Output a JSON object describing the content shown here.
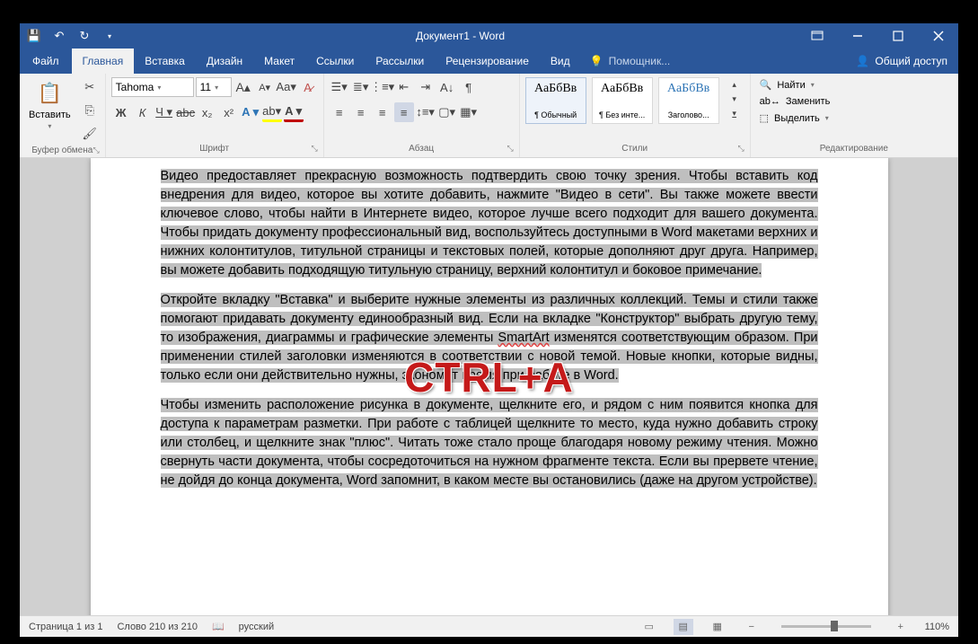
{
  "title": "Документ1 - Word",
  "tabs": {
    "file": "Файл",
    "home": "Главная",
    "insert": "Вставка",
    "design": "Дизайн",
    "layout": "Макет",
    "references": "Ссылки",
    "mailings": "Рассылки",
    "review": "Рецензирование",
    "view": "Вид"
  },
  "tell_me": "Помощник...",
  "share": "Общий доступ",
  "ribbon": {
    "clipboard": {
      "label": "Буфер обмена",
      "paste": "Вставить"
    },
    "font": {
      "label": "Шрифт",
      "name": "Tahoma",
      "size": "11"
    },
    "paragraph": {
      "label": "Абзац"
    },
    "styles": {
      "label": "Стили",
      "items": [
        {
          "preview": "АаБбВв",
          "name": "¶ Обычный"
        },
        {
          "preview": "АаБбВв",
          "name": "¶ Без инте..."
        },
        {
          "preview": "АаБбВв",
          "name": "Заголово..."
        }
      ]
    },
    "editing": {
      "label": "Редактирование",
      "find": "Найти",
      "replace": "Заменить",
      "select": "Выделить"
    }
  },
  "document": {
    "p1": "Видео предоставляет прекрасную возможность подтвердить свою точку зрения. Чтобы вставить код внедрения для видео, которое вы хотите добавить, нажмите \"Видео в сети\". Вы также можете ввести ключевое слово, чтобы найти в Интернете видео, которое лучше всего подходит для вашего документа. Чтобы придать документу профессиональный вид, воспользуйтесь доступными в Word макетами верхних и нижних колонтитулов, титульной страницы и текстовых полей, которые дополняют друг друга. Например, вы можете добавить подходящую титульную страницу, верхний колонтитул и боковое примечание.",
    "p2a": "Откройте вкладку \"Вставка\" и выберите нужные элементы из различных коллекций. Темы и стили также помогают придавать документу единообразный вид. Если на вкладке \"Конструктор\" выбрать другую тему, то изображения, диаграммы и графические элементы ",
    "p2b": "SmartArt",
    "p2c": " изменятся соответствующим образом. При применении стилей заголовки изменяются в соответствии с новой темой. Новые кнопки, которые видны, только если они действительно нужны, экономят время при работе в Word.",
    "p3": "Чтобы изменить расположение рисунка в документе, щелкните его, и рядом с ним появится кнопка для доступа к параметрам разметки. При работе с таблицей щелкните то место, куда нужно добавить строку или столбец, и щелкните знак \"плюс\". Читать тоже стало проще благодаря новому режиму чтения. Можно свернуть части документа, чтобы сосредоточиться на нужном фрагменте текста. Если вы прервете чтение, не дойдя до конца документа, Word запомнит, в каком месте вы остановились (даже на другом устройстве)."
  },
  "overlay": "CTRL+A",
  "status": {
    "page": "Страница 1 из 1",
    "words": "Слово 210 из 210",
    "lang": "русский",
    "zoom": "110%"
  }
}
